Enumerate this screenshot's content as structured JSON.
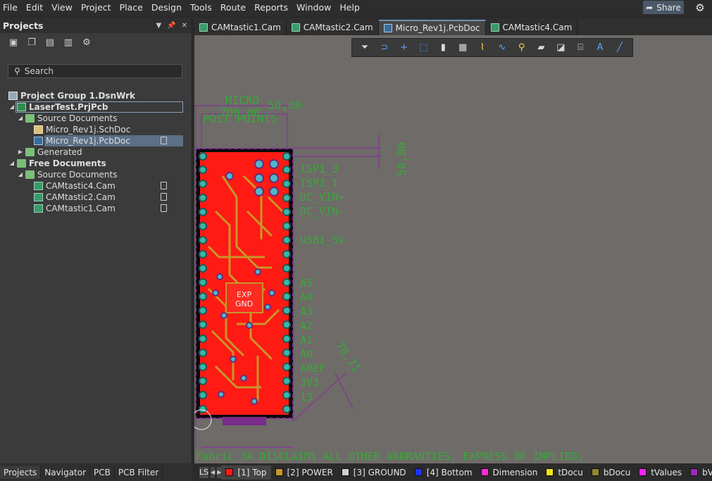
{
  "menu": [
    "File",
    "Edit",
    "View",
    "Project",
    "Place",
    "Design",
    "Tools",
    "Route",
    "Reports",
    "Window",
    "Help"
  ],
  "share_label": "Share",
  "panel": {
    "title": "Projects",
    "search_placeholder": "Search",
    "tree": [
      {
        "label": "Project Group 1.DsnWrk",
        "bold": true
      },
      {
        "label": "LaserTest.PrjPcb",
        "bold": true
      },
      {
        "label": "Source Documents"
      },
      {
        "label": "Micro_Rev1j.SchDoc"
      },
      {
        "label": "Micro_Rev1j.PcbDoc"
      },
      {
        "label": "Generated"
      },
      {
        "label": "Free Documents",
        "bold": true
      },
      {
        "label": "Source Documents"
      },
      {
        "label": "CAMtastic4.Cam"
      },
      {
        "label": "CAMtastic2.Cam"
      },
      {
        "label": "CAMtastic1.Cam"
      }
    ],
    "bottom_tabs": [
      "Projects",
      "Navigator",
      "PCB",
      "PCB Filter"
    ]
  },
  "doc_tabs": [
    {
      "label": "CAMtastic1.Cam",
      "icon": "cam-icon"
    },
    {
      "label": "CAMtastic2.Cam",
      "icon": "cam-icon"
    },
    {
      "label": "Micro_Rev1j.PcbDoc",
      "icon": "pcb-icon",
      "active": true
    },
    {
      "label": "CAMtastic4.Cam",
      "icon": "cam-icon"
    }
  ],
  "canvas": {
    "title_text": "MICRO",
    "dim_top_left": "700,00",
    "dim_top_right": "50,00",
    "dim_side": "50,00",
    "dim_diag": "70,71",
    "points_text": "POST POINTS",
    "pin_labels": [
      "ISP1_3",
      "ISP1_1",
      "DC_VIN+",
      "DC_VIN-",
      "USB1_5V",
      "A5",
      "A4",
      "A3",
      "A2",
      "A1",
      "A0",
      "AREF",
      "3V3",
      "13"
    ],
    "exp_label": "EXP",
    "gnd_label": "GND",
    "footer_text": "Fabric 3A DISCLAIMS ALL OTHER WARRANTIES, EXPRESS OR IMPLIED,"
  },
  "layer_bar": {
    "ls_label": "LS",
    "layers": [
      {
        "label": "[1] Top",
        "color": "#ff1a1a",
        "active": true
      },
      {
        "label": "[2] POWER",
        "color": "#c8952a"
      },
      {
        "label": "[3] GROUND",
        "color": "#d0d0d0"
      },
      {
        "label": "[4] Bottom",
        "color": "#1a35ff"
      },
      {
        "label": "Dimension",
        "color": "#ff2bd6"
      },
      {
        "label": "tDocu",
        "color": "#f7e21b"
      },
      {
        "label": "bDocu",
        "color": "#8c8a2a"
      },
      {
        "label": "tValues",
        "color": "#ff22ff"
      },
      {
        "label": "bV",
        "color": "#9b2bb8"
      }
    ]
  }
}
